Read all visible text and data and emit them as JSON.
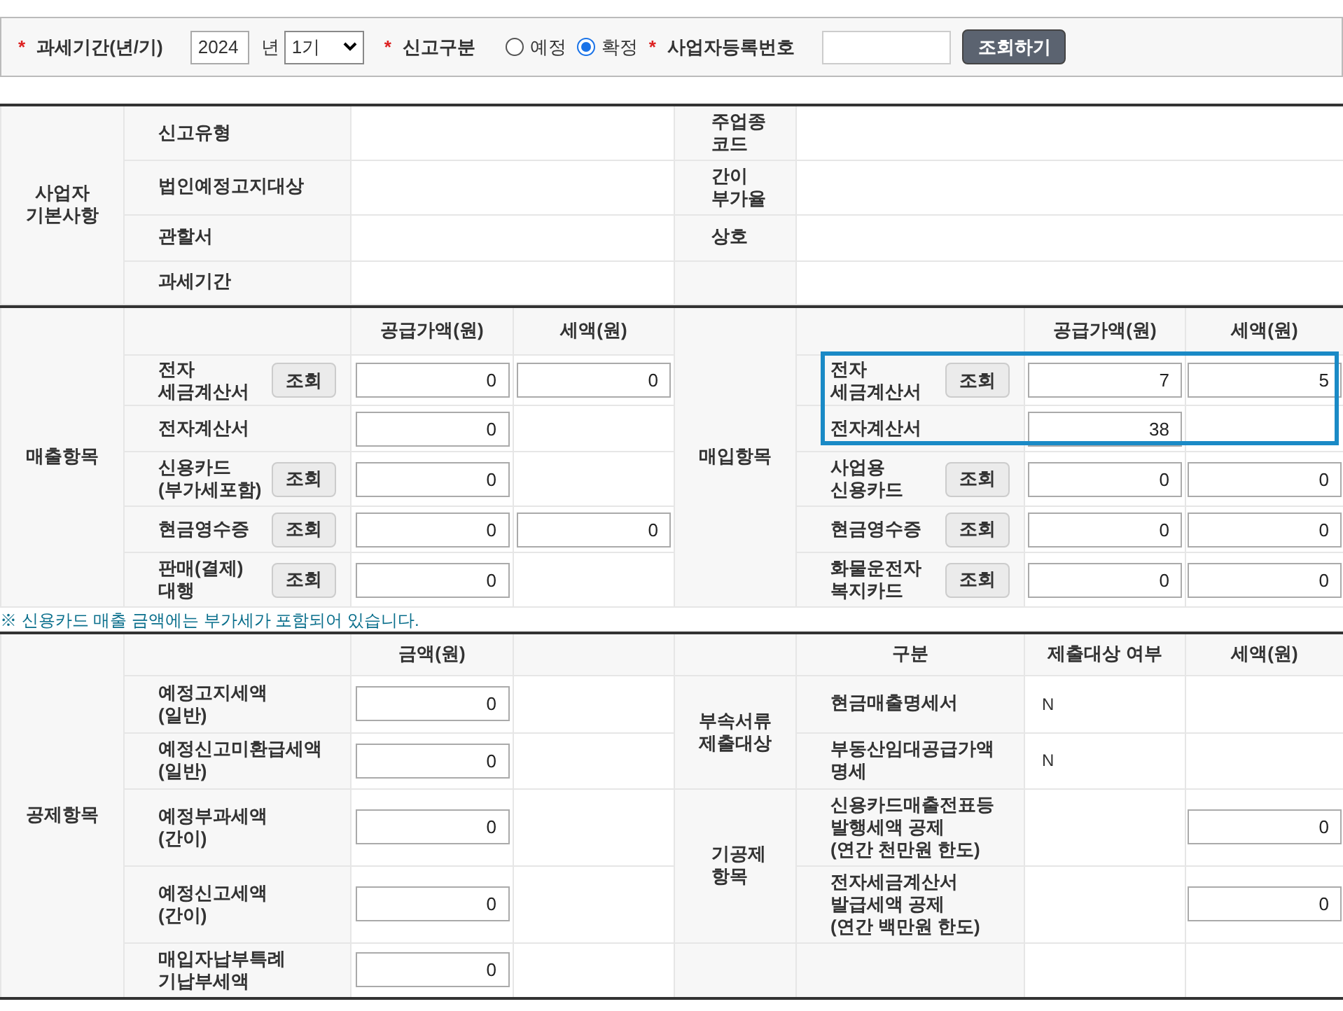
{
  "search_bar": {
    "required_mark": "*",
    "tax_period_label": "과세기간(년/기)",
    "year": "2024",
    "year_unit": "년",
    "period": "1기",
    "report_type_label": "신고구분",
    "report_types": [
      {
        "label": "예정",
        "selected": false
      },
      {
        "label": "확정",
        "selected": true
      }
    ],
    "business_number_label": "사업자등록번호",
    "search_button": "조회하기"
  },
  "basic_info": {
    "label": "사업자\n기본사항",
    "rows": [
      {
        "left": "신고유형",
        "right": "주업종\n코드"
      },
      {
        "left": "법인예정고지대상",
        "right": "간이\n부가율"
      },
      {
        "left": "관할서",
        "right": "상호"
      },
      {
        "left": "과세기간"
      }
    ]
  },
  "sales": {
    "label": "매출항목",
    "columns": [
      "공급가액(원)",
      "세액(원)"
    ],
    "rows": [
      {
        "label": "전자\n세금계산서",
        "button": "조회",
        "supply": "0",
        "tax": "0"
      },
      {
        "label": "전자계산서",
        "supply": "0"
      },
      {
        "label": "신용카드\n(부가세포함)",
        "button": "조회",
        "supply": "0"
      },
      {
        "label": "현금영수증",
        "button": "조회",
        "supply": "0",
        "tax": "0"
      },
      {
        "label": "판매(결제)\n대행",
        "button": "조회",
        "supply": "0"
      }
    ]
  },
  "purchases": {
    "label": "매입항목",
    "columns": [
      "공급가액(원)",
      "세액(원)"
    ],
    "highlight_box": true,
    "rows": [
      {
        "label": "전자\n세금계산서",
        "button": "조회",
        "supply": "7",
        "tax": "5"
      },
      {
        "label": "전자계산서",
        "supply": "38"
      },
      {
        "label": "사업용\n신용카드",
        "button": "조회",
        "supply": "0",
        "tax": "0"
      },
      {
        "label": "현금영수증",
        "button": "조회",
        "supply": "0",
        "tax": "0"
      },
      {
        "label": "화물운전자\n복지카드",
        "button": "조회",
        "supply": "0",
        "tax": "0"
      }
    ]
  },
  "note": "※ 신용카드 매출 금액에는 부가세가 포함되어 있습니다.",
  "deductions": {
    "label": "공제항목",
    "column": "금액(원)",
    "rows": [
      {
        "label": "예정고지세액\n(일반)",
        "amount": "0"
      },
      {
        "label": "예정신고미환급세액\n(일반)",
        "amount": "0"
      },
      {
        "label": "예정부과세액\n(간이)",
        "amount": "0"
      },
      {
        "label": "예정신고세액\n(간이)",
        "amount": "0"
      },
      {
        "label": "매입자납부특례\n기납부세액",
        "amount": "0"
      }
    ]
  },
  "attachments": {
    "label": "부속서류\n제출대상",
    "columns": [
      "구분",
      "제출대상 여부",
      "세액(원)"
    ],
    "rows": [
      {
        "label": "현금매출명세서",
        "submit": "N"
      },
      {
        "label": "부동산임대공급가액\n명세",
        "submit": "N"
      }
    ]
  },
  "pre_deductions": {
    "label": "기공제\n항목",
    "rows": [
      {
        "label": "신용카드매출전표등\n발행세액 공제\n(연간 천만원 한도)",
        "tax": "0"
      },
      {
        "label": "전자세금계산서\n발급세액 공제\n(연간 백만원 한도)",
        "tax": "0"
      }
    ]
  }
}
